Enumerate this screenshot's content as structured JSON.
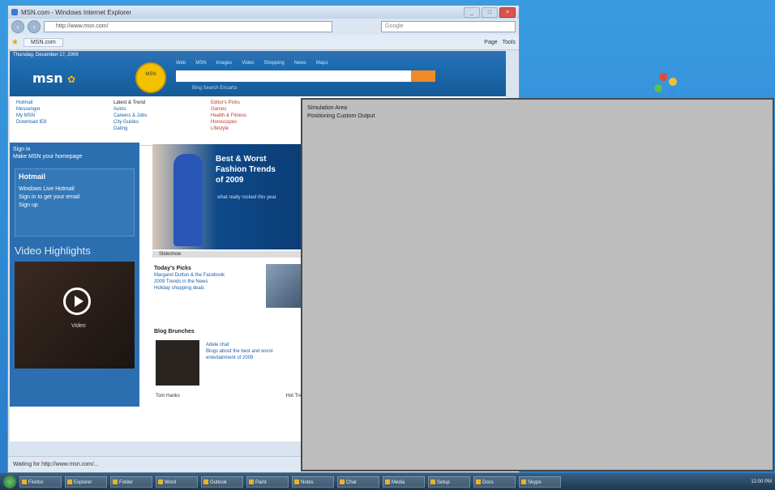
{
  "browser": {
    "title": "MSN.com - Windows Internet Explorer",
    "address": "http://www.msn.com/",
    "search_placeholder": "Google",
    "tab_label": "MSN.com",
    "tools": [
      "Page",
      "Tools"
    ],
    "status": "Waiting for http://www.msn.com/..."
  },
  "msn": {
    "date_strip": "Thursday, December 17, 2009",
    "logo": "msn",
    "badge": "MSN",
    "nav": [
      "Web",
      "MSN",
      "Images",
      "Video",
      "Shopping",
      "News",
      "Maps"
    ],
    "sublinks": "Bing Search   Encarta",
    "col1": [
      "Hotmail",
      "Messenger",
      "My MSN",
      "Download IE8"
    ],
    "col2": [
      "Autos",
      "Careers & Jobs",
      "City Guides",
      "Dating"
    ],
    "col3": [
      "Games",
      "Health & Fitness",
      "Horoscopes",
      "Lifestyle"
    ],
    "col3_head": "Editor's Picks",
    "col2_head": "Latest & Trend",
    "signin": "Sign in",
    "signin_sub": "Make MSN your homepage",
    "hotmail_head": "Hotmail",
    "hotmail_lines": [
      "Windows Live Hotmail",
      "Sign in to get your email",
      "Sign up"
    ],
    "video_head": "Video Highlights",
    "video_label": "Video",
    "feature_title": [
      "Best & Worst",
      "Fashion Trends",
      "of 2009"
    ],
    "feature_sub": "what really rocked this year",
    "feature_caption": "Slideshow",
    "today_head": "Today's Picks",
    "today_lines": [
      "Margaret Dutton & the Facebook",
      "2009 Trends in the News",
      "Holiday shopping deals"
    ],
    "blog_head": "Blog Brunches",
    "blog_lines": [
      "Adele chat",
      "Blogs about the best and worst",
      "entertainment of 2009"
    ],
    "blog_foot_left": "Tom Hanks",
    "blog_foot_right": "Hot Trends"
  },
  "overlay": {
    "line1": "Simulation Area",
    "line2": "Positioning Custom Output"
  },
  "taskbar": {
    "buttons": [
      "Firefox",
      "Explorer",
      "Folder",
      "Word",
      "Outlook",
      "Paint",
      "Notes",
      "Chat",
      "Media",
      "Setup",
      "Docs",
      "Skype"
    ],
    "tray": "12:00 PM"
  }
}
